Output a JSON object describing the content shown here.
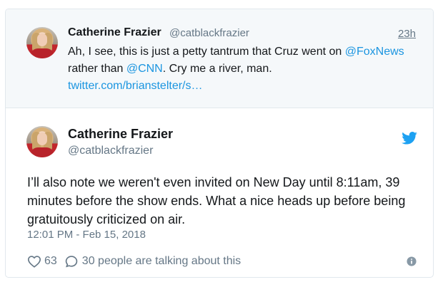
{
  "quoted_tweet": {
    "author_name": "Catherine Frazier",
    "author_handle": "@catblackfrazier",
    "time": "23h",
    "text_intro": "Ah, I see, this is just a petty tantrum that Cruz went on ",
    "mention_1": "@FoxNews",
    "text_mid": " rather than ",
    "mention_2": "@CNN",
    "text_end": ". Cry me a river, man.",
    "link": "twitter.com/brianstelter/s…"
  },
  "tweet": {
    "author_name": "Catherine Frazier",
    "author_handle": "@catblackfrazier",
    "text": "I’ll also note we weren't even invited on New Day until 8:11am, 39 minutes before the show ends. What a nice heads up before being gratuitously criticized on air.",
    "timestamp": "12:01 PM - Feb 15, 2018",
    "likes": "63",
    "talking_label": "30 people are talking about this"
  },
  "icons": {
    "brand": "twitter-bird-icon",
    "like": "heart-icon",
    "reply": "speech-bubble-icon",
    "info": "info-icon"
  },
  "colors": {
    "link": "#1b95e0",
    "text": "#14171a",
    "muted": "#657786",
    "quoted_bg": "#f5f8fa",
    "border": "#e1e8ed"
  }
}
